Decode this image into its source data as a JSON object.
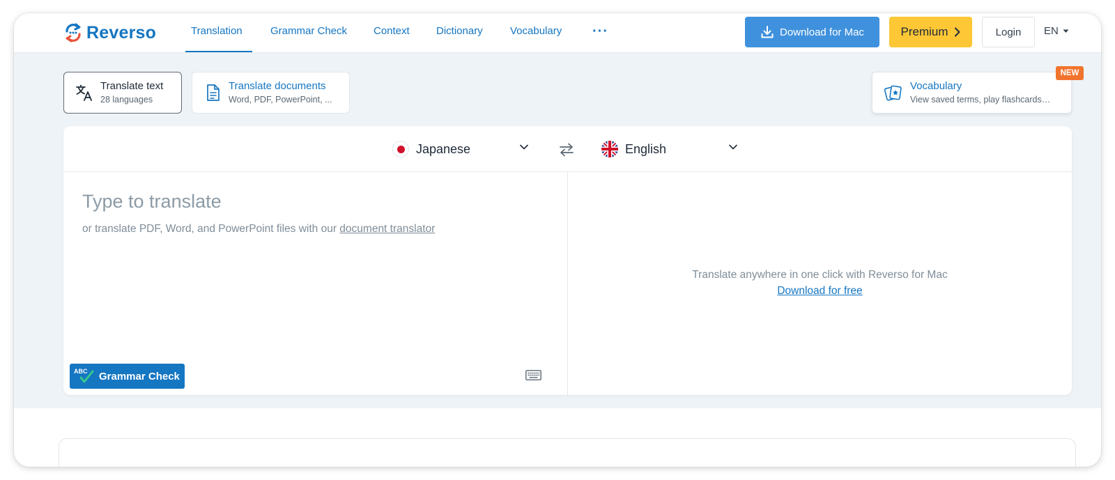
{
  "nav": {
    "brand": "Reverso",
    "links": [
      "Translation",
      "Grammar Check",
      "Context",
      "Dictionary",
      "Vocabulary"
    ],
    "more": "···",
    "download": "Download for Mac",
    "premium": "Premium",
    "login": "Login",
    "language": "EN"
  },
  "tools": {
    "translate_text": {
      "title": "Translate text",
      "subtitle": "28 languages"
    },
    "translate_docs": {
      "title": "Translate documents",
      "subtitle": "Word, PDF, PowerPoint, ..."
    },
    "vocabulary": {
      "title": "Vocabulary",
      "subtitle": "View saved terms, play flashcards…",
      "badge": "NEW"
    }
  },
  "translator": {
    "source_lang": "Japanese",
    "target_lang": "English",
    "placeholder": "Type to translate",
    "hint_prefix": "or translate PDF, Word, and PowerPoint files with our ",
    "hint_link": "document translator",
    "grammar_button": "Grammar Check",
    "grammar_icon_text": "ABC",
    "promo_text": "Translate anywhere in one click with Reverso for Mac",
    "promo_link": "Download for free"
  },
  "colors": {
    "brand": "#1576c2",
    "download_button": "#3f91dd",
    "premium_button": "#fdc735",
    "new_badge": "#f1742e",
    "hero_background": "#eef3f7"
  }
}
